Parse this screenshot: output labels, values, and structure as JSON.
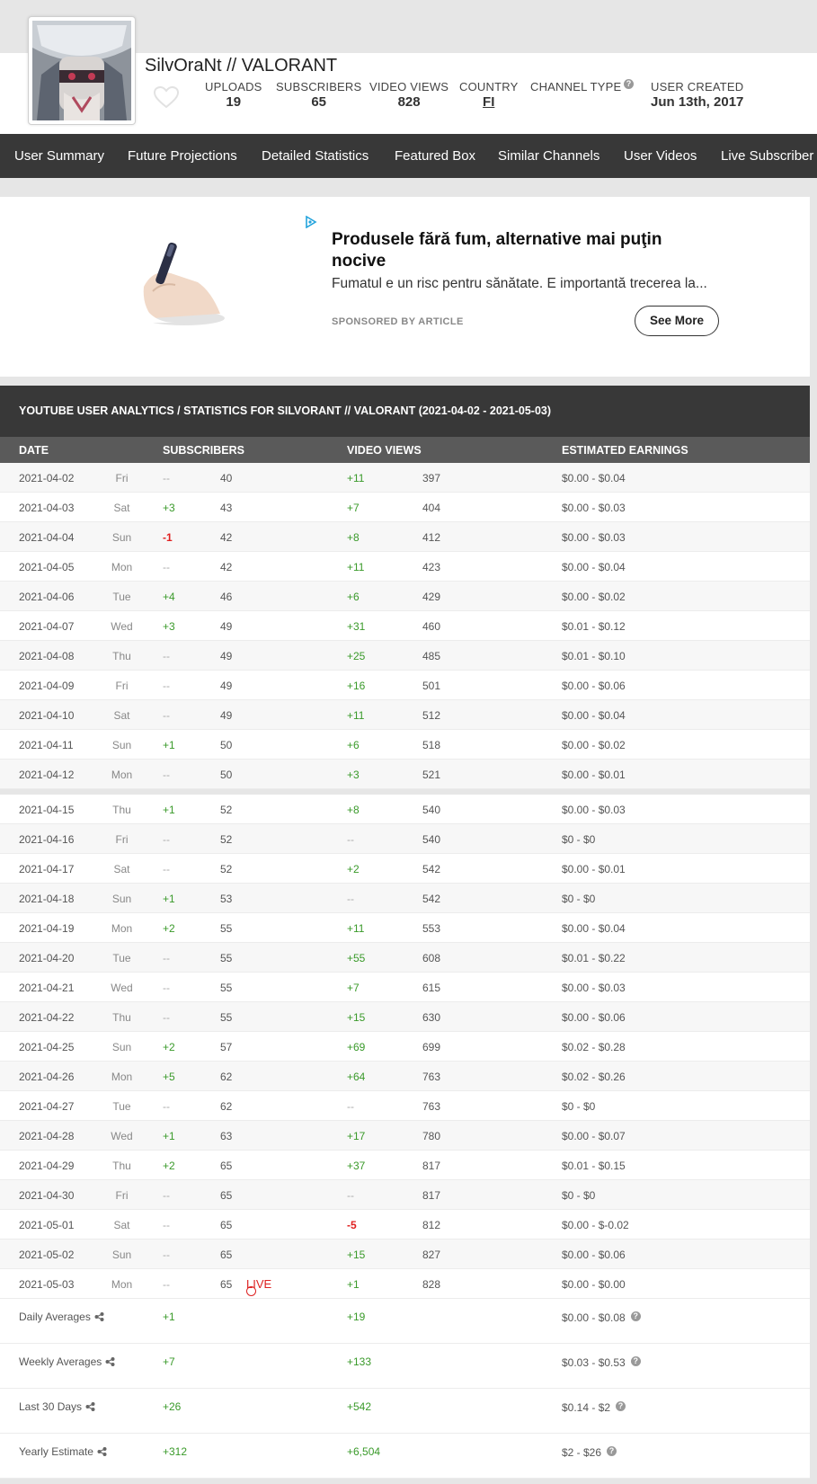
{
  "channel": {
    "name": "SilvOraNt // VALORANT",
    "stats": [
      {
        "label": "UPLOADS",
        "value": "19"
      },
      {
        "label": "SUBSCRIBERS",
        "value": "65"
      },
      {
        "label": "VIDEO VIEWS",
        "value": "828"
      },
      {
        "label": "COUNTRY",
        "value": "FI"
      },
      {
        "label": "CHANNEL TYPE",
        "value": ""
      },
      {
        "label": "USER CREATED",
        "value": "Jun 13th, 2017"
      }
    ]
  },
  "nav": [
    "User Summary",
    "Future Projections",
    "Detailed Statistics",
    "Featured Box",
    "Similar Channels",
    "User Videos",
    "Live Subscriber C"
  ],
  "ad": {
    "title": "Produsele fără fum, alternative mai puţin nocive",
    "description": "Fumatul e un risc pentru sănătate. E importantă trecerea la...",
    "sponsor": "SPONSORED BY ARTICLE",
    "button": "See More"
  },
  "table": {
    "title": "YOUTUBE USER ANALYTICS / STATISTICS FOR SILVORANT // VALORANT (2021-04-02 - 2021-05-03)",
    "headers": {
      "date": "DATE",
      "subscribers": "SUBSCRIBERS",
      "views": "VIDEO VIEWS",
      "earnings": "ESTIMATED EARNINGS"
    },
    "live_label": "LIVE",
    "rows": [
      {
        "date": "2021-04-02",
        "dow": "Fri",
        "sub_delta": "--",
        "subs": "40",
        "view_delta": "+11",
        "views": "397",
        "earnings": "$0.00  -  $0.04"
      },
      {
        "date": "2021-04-03",
        "dow": "Sat",
        "sub_delta": "+3",
        "subs": "43",
        "view_delta": "+7",
        "views": "404",
        "earnings": "$0.00  -  $0.03"
      },
      {
        "date": "2021-04-04",
        "dow": "Sun",
        "sub_delta": "-1",
        "subs": "42",
        "view_delta": "+8",
        "views": "412",
        "earnings": "$0.00  -  $0.03"
      },
      {
        "date": "2021-04-05",
        "dow": "Mon",
        "sub_delta": "--",
        "subs": "42",
        "view_delta": "+11",
        "views": "423",
        "earnings": "$0.00  -  $0.04"
      },
      {
        "date": "2021-04-06",
        "dow": "Tue",
        "sub_delta": "+4",
        "subs": "46",
        "view_delta": "+6",
        "views": "429",
        "earnings": "$0.00  -  $0.02"
      },
      {
        "date": "2021-04-07",
        "dow": "Wed",
        "sub_delta": "+3",
        "subs": "49",
        "view_delta": "+31",
        "views": "460",
        "earnings": "$0.01  -  $0.12"
      },
      {
        "date": "2021-04-08",
        "dow": "Thu",
        "sub_delta": "--",
        "subs": "49",
        "view_delta": "+25",
        "views": "485",
        "earnings": "$0.01  -  $0.10"
      },
      {
        "date": "2021-04-09",
        "dow": "Fri",
        "sub_delta": "--",
        "subs": "49",
        "view_delta": "+16",
        "views": "501",
        "earnings": "$0.00  -  $0.06"
      },
      {
        "date": "2021-04-10",
        "dow": "Sat",
        "sub_delta": "--",
        "subs": "49",
        "view_delta": "+11",
        "views": "512",
        "earnings": "$0.00  -  $0.04"
      },
      {
        "date": "2021-04-11",
        "dow": "Sun",
        "sub_delta": "+1",
        "subs": "50",
        "view_delta": "+6",
        "views": "518",
        "earnings": "$0.00  -  $0.02"
      },
      {
        "date": "2021-04-12",
        "dow": "Mon",
        "sub_delta": "--",
        "subs": "50",
        "view_delta": "+3",
        "views": "521",
        "earnings": "$0.00  -  $0.01"
      },
      {
        "date": "2021-04-15",
        "dow": "Thu",
        "sub_delta": "+1",
        "subs": "52",
        "view_delta": "+8",
        "views": "540",
        "earnings": "$0.00  -  $0.03"
      },
      {
        "date": "2021-04-16",
        "dow": "Fri",
        "sub_delta": "--",
        "subs": "52",
        "view_delta": "--",
        "views": "540",
        "earnings": "$0  -  $0"
      },
      {
        "date": "2021-04-17",
        "dow": "Sat",
        "sub_delta": "--",
        "subs": "52",
        "view_delta": "+2",
        "views": "542",
        "earnings": "$0.00  -  $0.01"
      },
      {
        "date": "2021-04-18",
        "dow": "Sun",
        "sub_delta": "+1",
        "subs": "53",
        "view_delta": "--",
        "views": "542",
        "earnings": "$0  -  $0"
      },
      {
        "date": "2021-04-19",
        "dow": "Mon",
        "sub_delta": "+2",
        "subs": "55",
        "view_delta": "+11",
        "views": "553",
        "earnings": "$0.00  -  $0.04"
      },
      {
        "date": "2021-04-20",
        "dow": "Tue",
        "sub_delta": "--",
        "subs": "55",
        "view_delta": "+55",
        "views": "608",
        "earnings": "$0.01  -  $0.22"
      },
      {
        "date": "2021-04-21",
        "dow": "Wed",
        "sub_delta": "--",
        "subs": "55",
        "view_delta": "+7",
        "views": "615",
        "earnings": "$0.00  -  $0.03"
      },
      {
        "date": "2021-04-22",
        "dow": "Thu",
        "sub_delta": "--",
        "subs": "55",
        "view_delta": "+15",
        "views": "630",
        "earnings": "$0.00  -  $0.06"
      },
      {
        "date": "2021-04-25",
        "dow": "Sun",
        "sub_delta": "+2",
        "subs": "57",
        "view_delta": "+69",
        "views": "699",
        "earnings": "$0.02  -  $0.28"
      },
      {
        "date": "2021-04-26",
        "dow": "Mon",
        "sub_delta": "+5",
        "subs": "62",
        "view_delta": "+64",
        "views": "763",
        "earnings": "$0.02  -  $0.26"
      },
      {
        "date": "2021-04-27",
        "dow": "Tue",
        "sub_delta": "--",
        "subs": "62",
        "view_delta": "--",
        "views": "763",
        "earnings": "$0  -  $0"
      },
      {
        "date": "2021-04-28",
        "dow": "Wed",
        "sub_delta": "+1",
        "subs": "63",
        "view_delta": "+17",
        "views": "780",
        "earnings": "$0.00  -  $0.07"
      },
      {
        "date": "2021-04-29",
        "dow": "Thu",
        "sub_delta": "+2",
        "subs": "65",
        "view_delta": "+37",
        "views": "817",
        "earnings": "$0.01  -  $0.15"
      },
      {
        "date": "2021-04-30",
        "dow": "Fri",
        "sub_delta": "--",
        "subs": "65",
        "view_delta": "--",
        "views": "817",
        "earnings": "$0  -  $0"
      },
      {
        "date": "2021-05-01",
        "dow": "Sat",
        "sub_delta": "--",
        "subs": "65",
        "view_delta": "-5",
        "views": "812",
        "earnings": "$0.00  -  $-0.02"
      },
      {
        "date": "2021-05-02",
        "dow": "Sun",
        "sub_delta": "--",
        "subs": "65",
        "view_delta": "+15",
        "views": "827",
        "earnings": "$0.00  -  $0.06"
      },
      {
        "date": "2021-05-03",
        "dow": "Mon",
        "sub_delta": "--",
        "subs": "65",
        "view_delta": "+1",
        "views": "828",
        "earnings": "$0.00  -  $0.00",
        "live": true
      }
    ],
    "summary": [
      {
        "label": "Daily Averages",
        "subs": "+1",
        "views": "+19",
        "earnings": "$0.00 - $0.08"
      },
      {
        "label": "Weekly Averages",
        "subs": "+7",
        "views": "+133",
        "earnings": "$0.03 - $0.53"
      },
      {
        "label": "Last 30 Days",
        "subs": "+26",
        "views": "+542",
        "earnings": "$0.14 - $2"
      },
      {
        "label": "Yearly Estimate",
        "subs": "+312",
        "views": "+6,504",
        "earnings": "$2 - $26"
      }
    ]
  },
  "colors": {
    "positive": "#3a9a2a",
    "negative": "#e02020",
    "nav_bg": "#383838",
    "header_row_bg": "#5a5a5a"
  }
}
